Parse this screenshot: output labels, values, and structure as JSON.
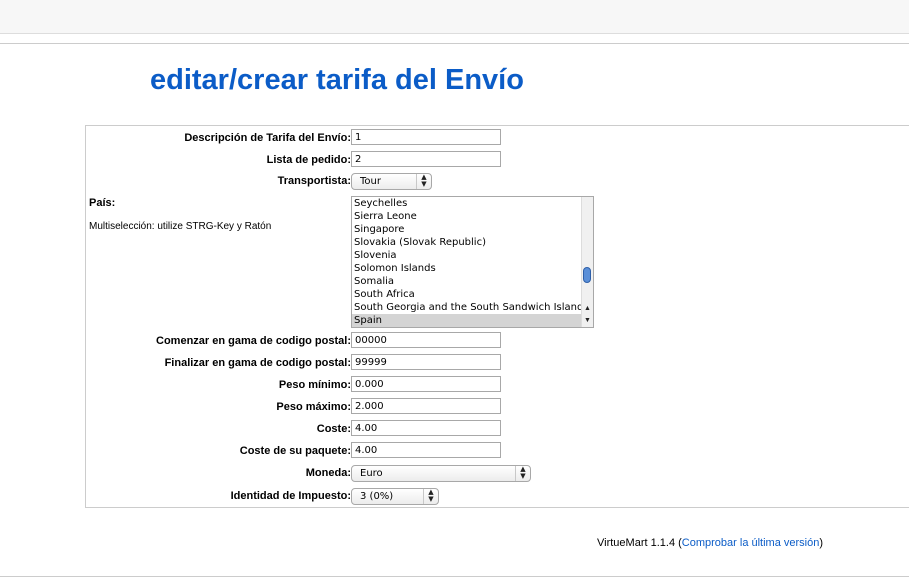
{
  "page": {
    "title": "editar/crear tarifa del Envío"
  },
  "form": {
    "descripcion": {
      "label": "Descripción de Tarifa del Envío:",
      "value": "1"
    },
    "lista": {
      "label": "Lista de pedido:",
      "value": "2"
    },
    "transportista": {
      "label": "Transportista:",
      "value": "Tour"
    },
    "pais": {
      "label": "País:",
      "note": "Multiselección: utilize STRG-Key y Ratón",
      "options": [
        "Seychelles",
        "Sierra Leone",
        "Singapore",
        "Slovakia (Slovak Republic)",
        "Slovenia",
        "Solomon Islands",
        "Somalia",
        "South Africa",
        "South Georgia and the South Sandwich Islands",
        "Spain"
      ],
      "selected": "Spain"
    },
    "zip_start": {
      "label": "Comenzar en gama de codigo postal:",
      "value": "00000"
    },
    "zip_end": {
      "label": "Finalizar en gama de codigo postal:",
      "value": "99999"
    },
    "peso_min": {
      "label": "Peso mínimo:",
      "value": "0.000"
    },
    "peso_max": {
      "label": "Peso máximo:",
      "value": "2.000"
    },
    "coste": {
      "label": "Coste:",
      "value": "4.00"
    },
    "coste_paquete": {
      "label": "Coste de su paquete:",
      "value": "4.00"
    },
    "moneda": {
      "label": "Moneda:",
      "value": "Euro"
    },
    "impuesto": {
      "label": "Identidad de Impuesto:",
      "value": "3 (0%)"
    }
  },
  "footer": {
    "version": "VirtueMart 1.1.4",
    "paren_open": " (",
    "link": "Comprobar la última versión",
    "paren_close": ")"
  },
  "colors": {
    "title": "#0b5cc7",
    "link": "#0b5cc7",
    "selected_option": "#d4d4d4",
    "scroll_thumb": "#5a8fd8"
  },
  "icons": {
    "select_arrows": "up-down-chevron-icon",
    "scroll_up": "triangle-up-icon",
    "scroll_down": "triangle-down-icon"
  }
}
